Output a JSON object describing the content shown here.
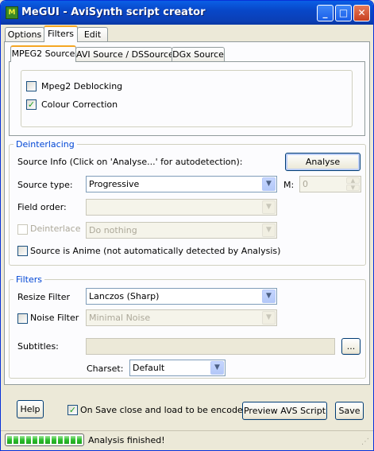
{
  "window": {
    "title": "MeGUI - AviSynth script creator",
    "icon_text": "M"
  },
  "titlebar_buttons": {
    "minimize": "_",
    "maximize": "□",
    "close": "✕"
  },
  "main_tabs": [
    {
      "label": "Options"
    },
    {
      "label": "Filters"
    },
    {
      "label": "Edit"
    }
  ],
  "source_tabs": [
    {
      "label": "MPEG2 Source"
    },
    {
      "label": "AVI Source / DSSource"
    },
    {
      "label": "DGx Source"
    }
  ],
  "mpeg2": {
    "deblocking_label": "Mpeg2 Deblocking",
    "deblocking_checked": false,
    "colour_correction_label": "Colour Correction",
    "colour_correction_checked": true
  },
  "deinterlacing": {
    "group_title": "Deinterlacing",
    "source_info_label": "Source Info (Click on 'Analyse...' for autodetection):",
    "analyse_button": "Analyse",
    "source_type_label": "Source type:",
    "source_type_value": "Progressive",
    "m_label": "M:",
    "m_value": "0",
    "field_order_label": "Field order:",
    "field_order_value": "",
    "deinterlace_label": "Deinterlace",
    "deinterlace_value": "Do nothing",
    "anime_label": "Source is Anime (not automatically detected by Analysis)"
  },
  "filters": {
    "group_title": "Filters",
    "resize_label": "Resize Filter",
    "resize_value": "Lanczos (Sharp)",
    "noise_label": "Noise Filter",
    "noise_value": "Minimal Noise",
    "subtitles_label": "Subtitles:",
    "subtitles_value": "",
    "browse_button": "...",
    "charset_label": "Charset:",
    "charset_value": "Default"
  },
  "bottom": {
    "help_button": "Help",
    "on_save_label": "On Save close and load to be encoded",
    "on_save_checked": true,
    "preview_button": "Preview AVS Script",
    "save_button": "Save"
  },
  "status": {
    "text": "Analysis finished!",
    "progress": 1.0
  }
}
